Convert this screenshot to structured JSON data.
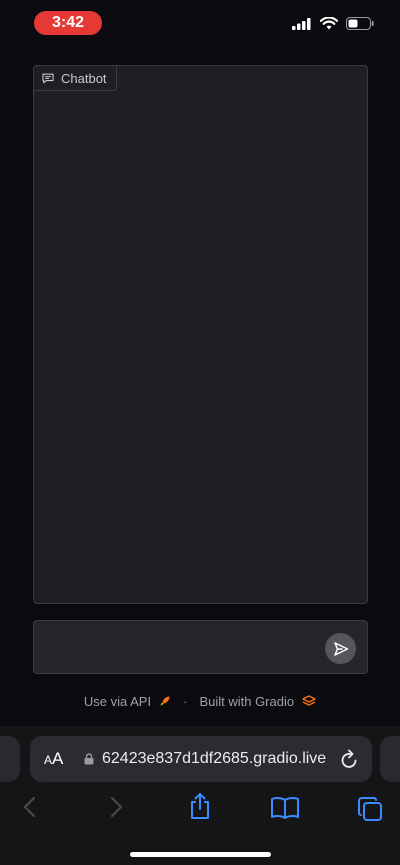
{
  "status_bar": {
    "time": "3:42",
    "icons": [
      "cellular-signal-icon",
      "wifi-icon",
      "battery-icon"
    ]
  },
  "chatbot": {
    "label": "Chatbot",
    "icon": "chat-bubble-icon",
    "messages": []
  },
  "input": {
    "value": "",
    "placeholder": "",
    "send_icon": "send-icon"
  },
  "footer": {
    "api_link": "Use via API",
    "separator": "·",
    "built_with": "Built with Gradio"
  },
  "browser": {
    "text_size_label_small": "A",
    "text_size_label_large": "A",
    "url": "62423e837d1df2685.gradio.live",
    "toolbar": [
      "back-icon",
      "forward-icon",
      "share-icon",
      "bookmarks-icon",
      "tabs-icon"
    ]
  },
  "colors": {
    "background": "#0b0b0f",
    "panel": "#1f1f23",
    "time_pill": "#e53935",
    "ios_blue": "#3a8bff",
    "gradio_orange": "#f97316"
  }
}
